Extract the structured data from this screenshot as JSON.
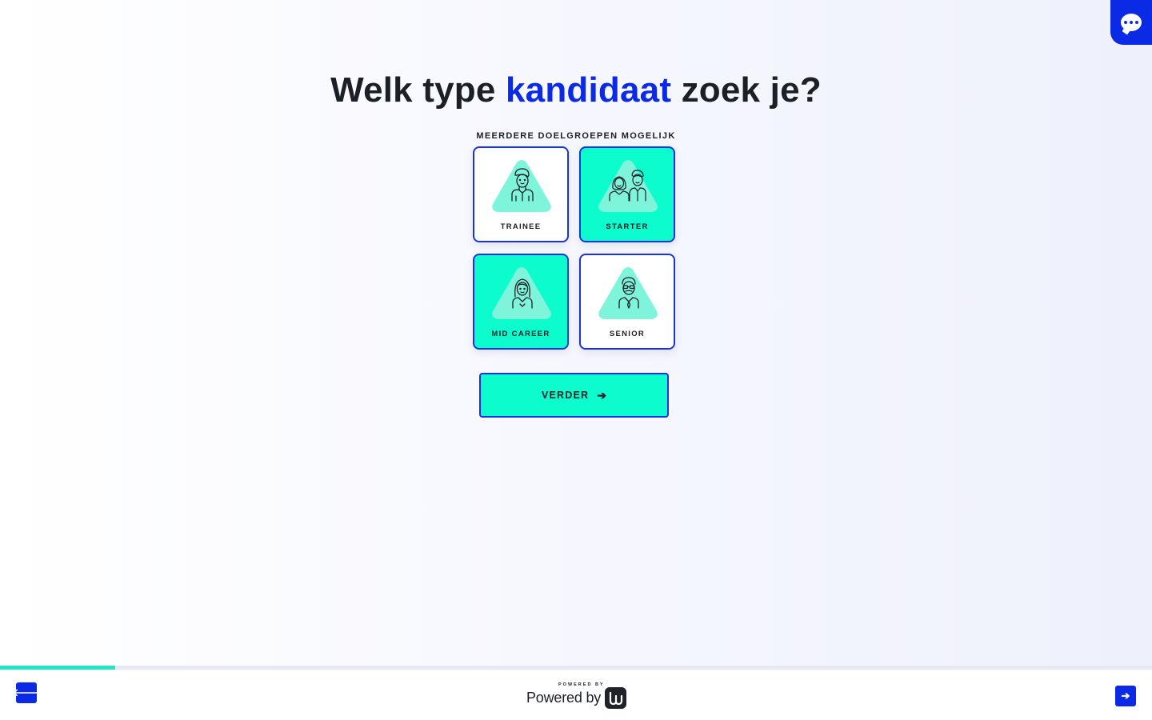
{
  "question": {
    "part1": "Welk type ",
    "highlight": "kandidaat",
    "part2": " zoek je?"
  },
  "hint": "MEERDERE DOELGROEPEN MOGELIJK",
  "options": [
    {
      "label": "TRAINEE",
      "selected": false,
      "icon": "trainee-person-icon"
    },
    {
      "label": "STARTER",
      "selected": true,
      "icon": "starter-persons-icon"
    },
    {
      "label": "MID CAREER",
      "selected": true,
      "icon": "mid-career-person-icon"
    },
    {
      "label": "SENIOR",
      "selected": false,
      "icon": "senior-person-icon"
    }
  ],
  "cta": {
    "label": "VERDER",
    "icon": "arrow-right-icon"
  },
  "progress": {
    "fraction": 0.1
  },
  "footer": {
    "powered_small": "POWERED BY",
    "powered_text": "Powered by",
    "logo": "powered-by-logo-icon",
    "prev_icon": "arrow-left-icon",
    "next_icon": "arrow-right-icon"
  },
  "chat": {
    "icon": "chat-bubble-icon"
  },
  "colors": {
    "accent_blue": "#0a2ae6",
    "selected_mint": "#0dfccd",
    "text_dark": "#1c1f26",
    "triangle_mint": "#7ef5da"
  }
}
